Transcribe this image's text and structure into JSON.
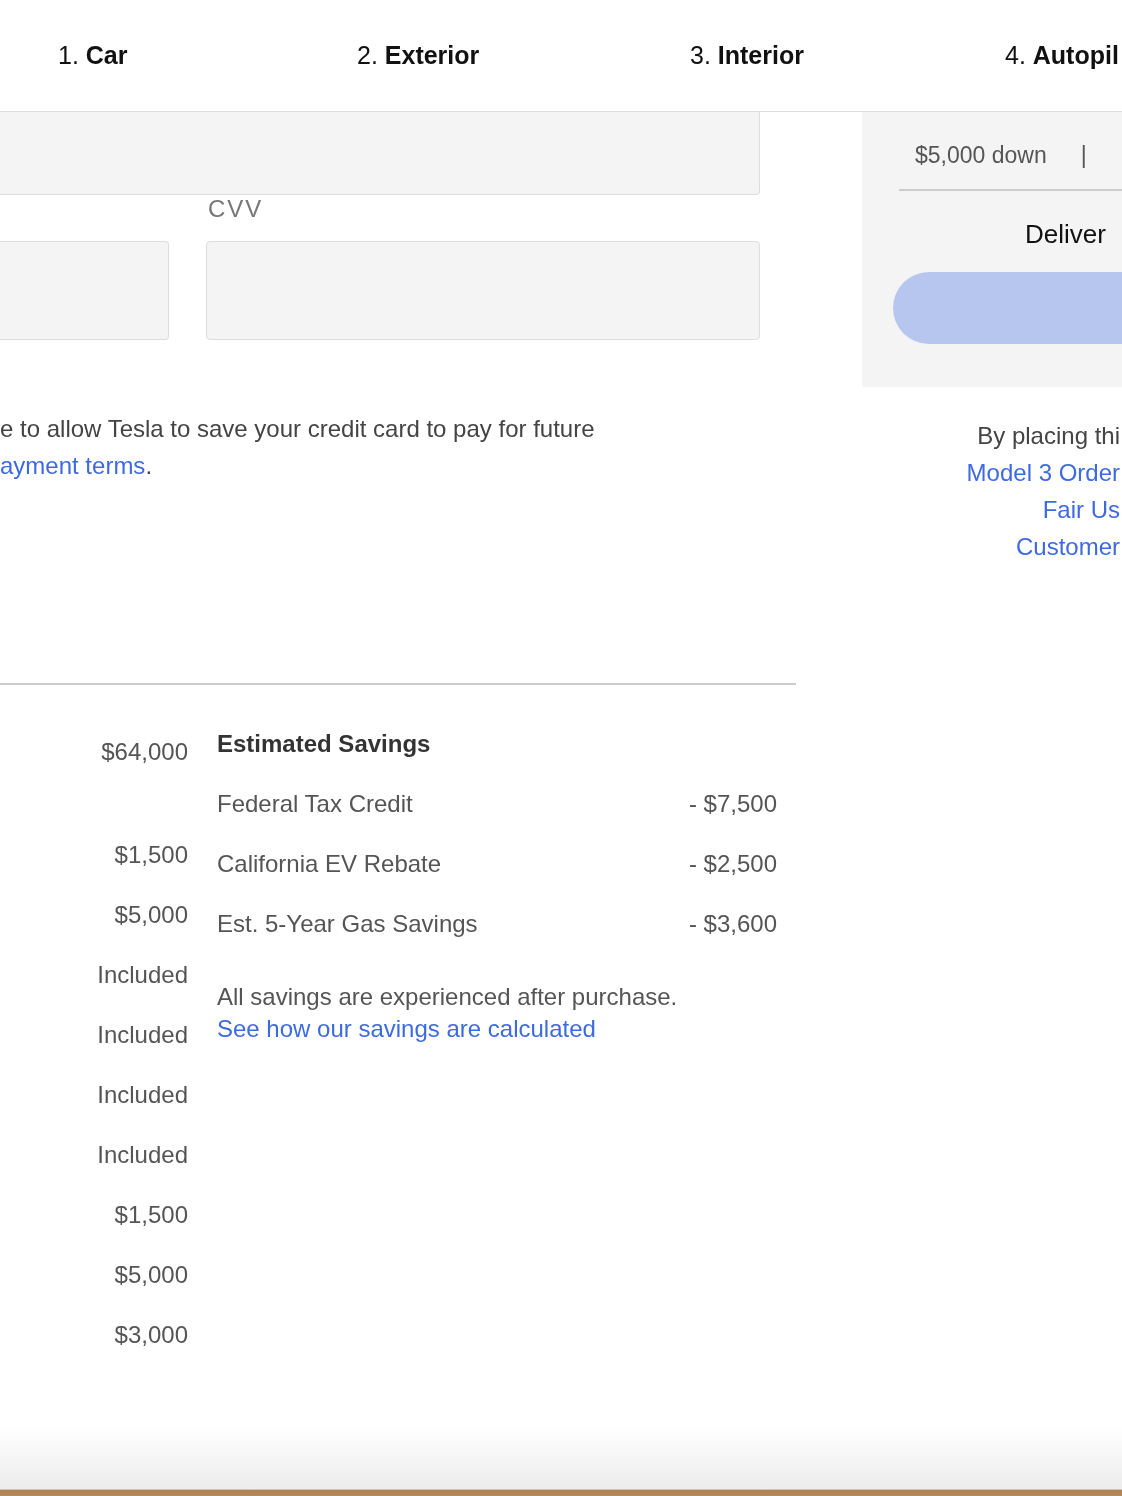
{
  "steps": [
    {
      "label": "1. **Car**",
      "selected": false
    },
    {
      "label": "2. **Exterior**",
      "selected": false
    },
    {
      "label": "3. **Interior**",
      "selected": false
    },
    {
      "label": "4. **Autopil**",
      "selected": false
    }
  ],
  "payment_form": {
    "cvv_label": "CVV",
    "consent_text": "e to allow Tesla to save your credit card to pay for future",
    "consent_link": "ayment terms",
    "consent_end": "."
  },
  "price_column": [
    "$64,000",
    "$1,500",
    "$5,000",
    "Included",
    "Included",
    "Included",
    "Included",
    "$1,500",
    "$5,000",
    "$3,000"
  ],
  "savings": {
    "title": "Estimated Savings",
    "items": [
      {
        "label": "Federal Tax Credit",
        "amount": "- $7,500"
      },
      {
        "label": "California EV Rebate",
        "amount": "- $2,500"
      },
      {
        "label": "Est. 5-Year Gas Savings",
        "amount": "- $3,600"
      }
    ],
    "note": "All savings are experienced after purchase.",
    "link": "See how our savings are calculated"
  },
  "summary": {
    "down_payment": "$5,000 down",
    "separator": "|",
    "delivery": "Deliver"
  },
  "agreement": {
    "text": "By placing thi",
    "links": [
      "Model 3 Order",
      "Fair Us",
      "Customer"
    ]
  }
}
